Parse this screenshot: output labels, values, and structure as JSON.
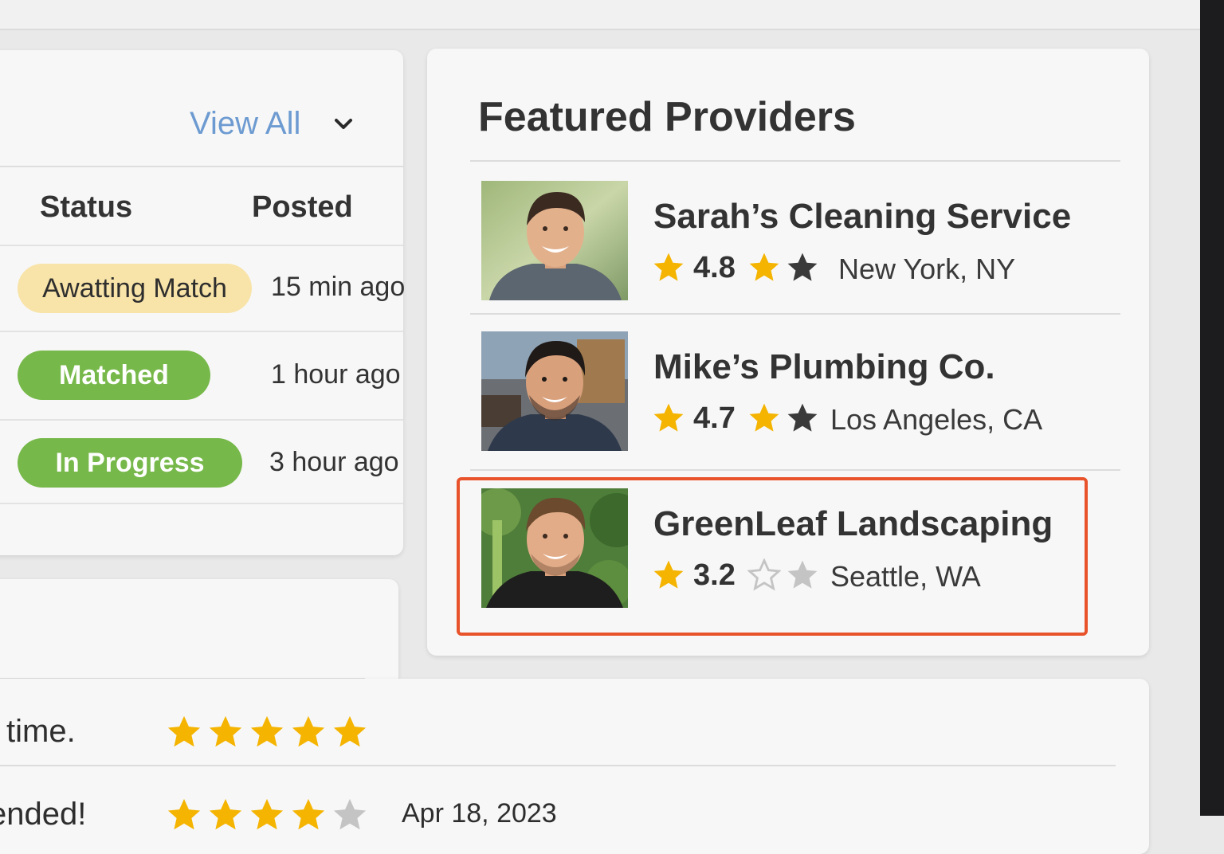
{
  "requests": {
    "view_all_label": "View All",
    "columns": {
      "status": "Status",
      "posted": "Posted"
    },
    "rows": [
      {
        "status": "Awatting Match",
        "posted": "15 min ago",
        "status_color": "#f8e3a8"
      },
      {
        "status": "Matched",
        "posted": "1 hour ago",
        "status_color": "#77b84a"
      },
      {
        "status": "In Progress",
        "posted": "3 hour ago",
        "status_color": "#77b84a"
      }
    ]
  },
  "featured": {
    "title": "Featured Providers",
    "providers": [
      {
        "name": "Sarah’s Cleaning Service",
        "rating": "4.8",
        "location": "New York, NY",
        "stars": [
          "full",
          "full",
          "dark"
        ]
      },
      {
        "name": "Mike’s Plumbing Co.",
        "rating": "4.7",
        "location": "Los Angeles, CA",
        "stars": [
          "full",
          "full",
          "dark"
        ]
      },
      {
        "name": "GreenLeaf Landscaping",
        "rating": "3.2",
        "location": "Seattle, WA",
        "stars": [
          "full",
          "empty",
          "empty"
        ],
        "highlighted": true
      }
    ],
    "highlight_color": "#e8532b"
  },
  "reviews": [
    {
      "text_fragment": "time.",
      "stars": 5,
      "date": ""
    },
    {
      "text_fragment": "ended!",
      "stars": 4,
      "date": "Apr 18, 2023"
    }
  ],
  "colors": {
    "accent_link": "#6d9bd1",
    "star_gold": "#f4b400",
    "star_dark": "#3a3a3a",
    "star_empty": "#c4c4c4",
    "pill_green": "#77b84a",
    "pill_yellow": "#f8e3a8"
  }
}
